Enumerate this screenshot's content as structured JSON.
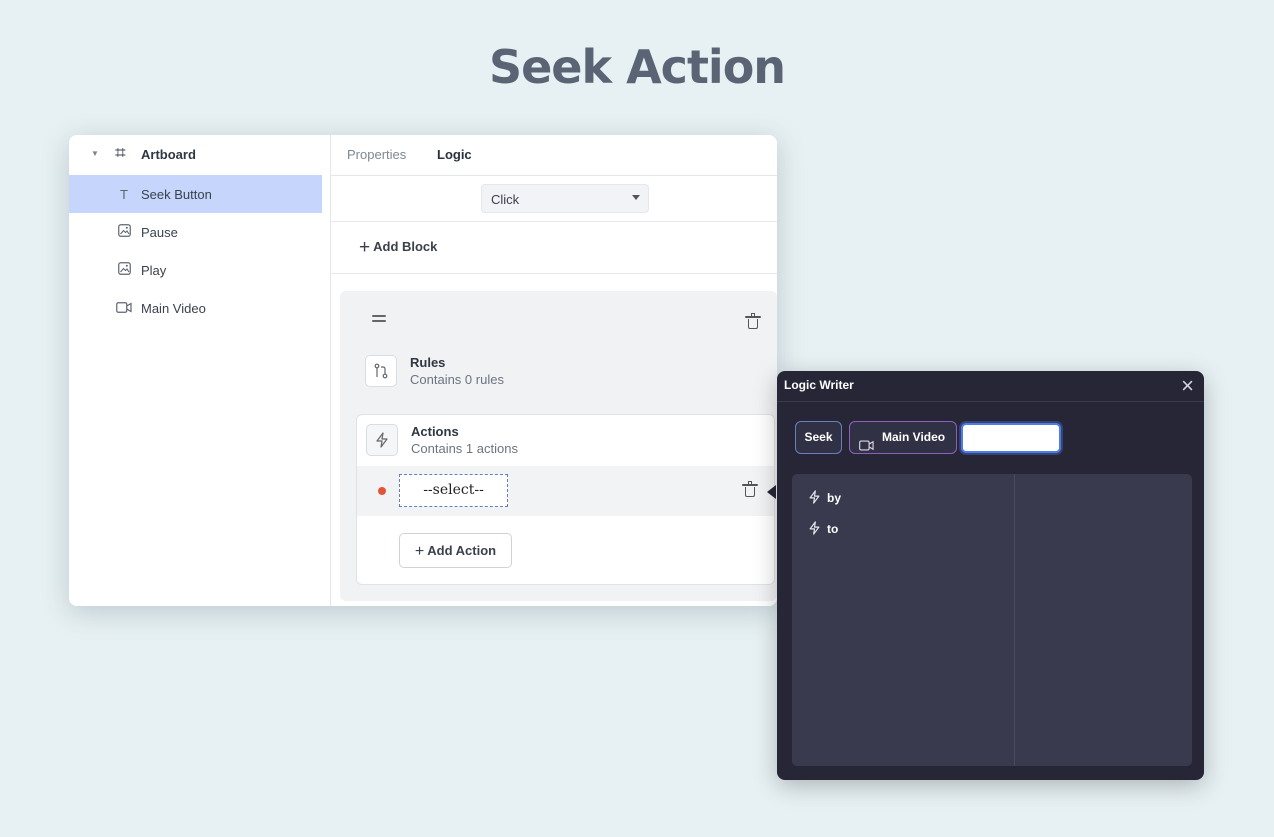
{
  "page": {
    "title": "Seek Action"
  },
  "layers": {
    "root": "Artboard",
    "items": [
      {
        "label": "Seek Button",
        "icon": "text-icon",
        "glyph": "T",
        "selected": true
      },
      {
        "label": "Pause",
        "icon": "image-icon",
        "glyph": "▨",
        "selected": false
      },
      {
        "label": "Play",
        "icon": "image-icon",
        "glyph": "▨",
        "selected": false
      },
      {
        "label": "Main Video",
        "icon": "video-icon",
        "glyph": "⊏",
        "selected": false
      }
    ]
  },
  "tabs": {
    "properties": "Properties",
    "logic": "Logic"
  },
  "trigger": {
    "value": "Click"
  },
  "add_block": {
    "plus": "+",
    "label": "Add Block"
  },
  "block": {
    "rules": {
      "title": "Rules",
      "subtitle": "Contains 0 rules"
    },
    "actions": {
      "title": "Actions",
      "subtitle": "Contains 1 actions"
    },
    "select": {
      "value": "--select--"
    },
    "add_action": {
      "plus": "+",
      "label": "Add Action"
    }
  },
  "logic_writer": {
    "title": "Logic Writer",
    "close": "×",
    "chips": {
      "seek": "Seek",
      "video": "Main Video"
    },
    "options": [
      "by",
      "to"
    ]
  }
}
